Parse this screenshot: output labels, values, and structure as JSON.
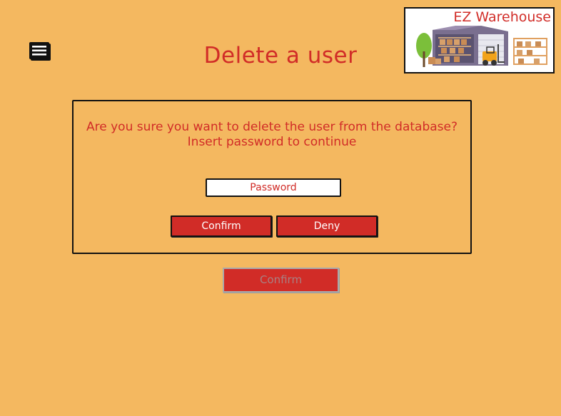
{
  "header": {
    "title": "Delete a user",
    "menu_icon": "menu-icon",
    "logo": {
      "text": "EZ Warehouse",
      "icon": "warehouse-logo"
    }
  },
  "dialog": {
    "message_line1": "Are you sure you want to delete the user from the database?",
    "message_line2": "Insert password to continue",
    "password": {
      "placeholder": "Password",
      "value": ""
    },
    "confirm_label": "Confirm",
    "deny_label": "Deny"
  },
  "footer": {
    "confirm_label": "Confirm",
    "confirm_state": "disabled"
  },
  "colors": {
    "background": "#f4b860",
    "accent": "#d12c27",
    "border": "#111111"
  }
}
